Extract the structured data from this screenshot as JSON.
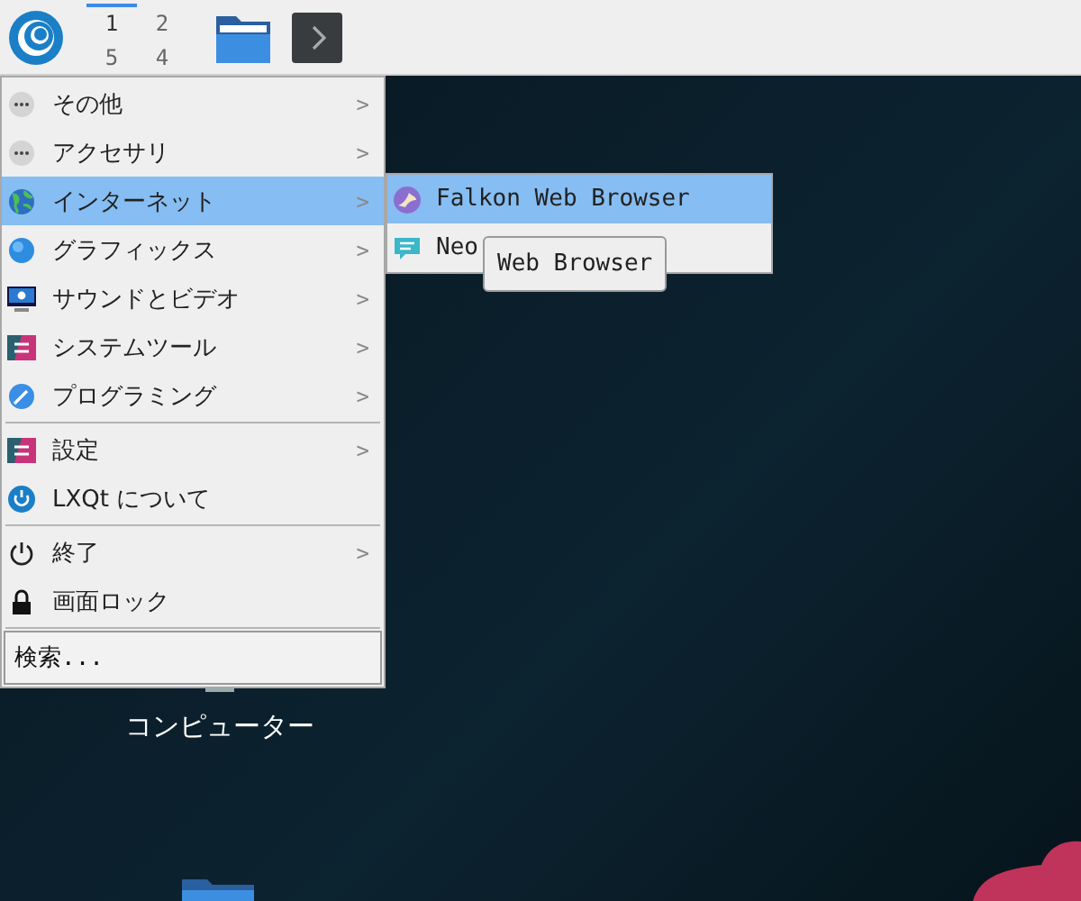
{
  "panel": {
    "workspaces": [
      {
        "label": "1",
        "selected": true
      },
      {
        "label": "2",
        "selected": false
      },
      {
        "label": "5",
        "selected": false
      },
      {
        "label": "4",
        "selected": false
      }
    ]
  },
  "menu": {
    "sections": [
      [
        {
          "label": "その他",
          "has_submenu": true,
          "selected": false
        },
        {
          "label": "アクセサリ",
          "has_submenu": true,
          "selected": false
        },
        {
          "label": "インターネット",
          "has_submenu": true,
          "selected": true
        },
        {
          "label": "グラフィックス",
          "has_submenu": true,
          "selected": false
        },
        {
          "label": "サウンドとビデオ",
          "has_submenu": true,
          "selected": false
        },
        {
          "label": "システムツール",
          "has_submenu": true,
          "selected": false
        },
        {
          "label": "プログラミング",
          "has_submenu": true,
          "selected": false
        }
      ],
      [
        {
          "label": "設定",
          "has_submenu": true,
          "selected": false
        },
        {
          "label": "LXQt について",
          "has_submenu": false,
          "selected": false
        }
      ],
      [
        {
          "label": "終了",
          "has_submenu": true,
          "selected": false
        },
        {
          "label": "画面ロック",
          "has_submenu": false,
          "selected": false
        }
      ]
    ],
    "arrow": ">",
    "search": {
      "placeholder": "検索..."
    }
  },
  "submenu": {
    "items": [
      {
        "label": "Falkon Web Browser",
        "selected": true
      },
      {
        "label": "Neo",
        "selected": false
      }
    ]
  },
  "tooltip": "Web Browser",
  "desktop": {
    "icons": [
      {
        "label": "コンピューター"
      }
    ]
  }
}
